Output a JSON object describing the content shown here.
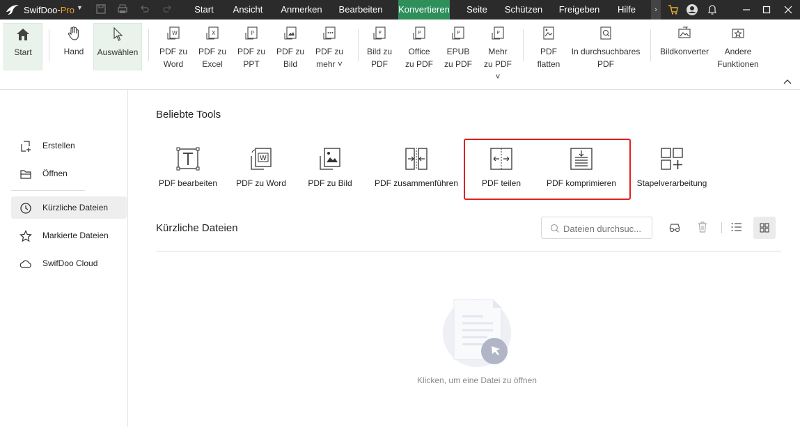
{
  "app": {
    "name": "SwifDoo-",
    "name_suffix": "Pro"
  },
  "menu": [
    "Start",
    "Ansicht",
    "Anmerken",
    "Bearbeiten",
    "Konvertieren",
    "Seite",
    "Schützen",
    "Freigeben",
    "Hilfe"
  ],
  "menu_active": "Konvertieren",
  "ribbon": {
    "start": "Start",
    "hand": "Hand",
    "select": "Auswählen",
    "pdf_word": "PDF zu\nWord",
    "pdf_excel": "PDF zu\nExcel",
    "pdf_ppt": "PDF zu\nPPT",
    "pdf_image": "PDF zu\nBild",
    "pdf_more": "PDF zu\nmehr ˅",
    "image_pdf": "Bild zu\nPDF",
    "office_pdf": "Office\nzu PDF",
    "epub_pdf": "EPUB\nzu PDF",
    "more_pdf": "Mehr\nzu PDF ˅",
    "pdf_flatten": "PDF\nflatten",
    "searchable_pdf": "In durchsuchbares\nPDF",
    "image_converter": "Bildkonverter",
    "other_functions": "Andere\nFunktionen"
  },
  "sidebar": {
    "create": "Erstellen",
    "open": "Öffnen",
    "recent": "Kürzliche Dateien",
    "starred": "Markierte Dateien",
    "cloud": "SwifDoo Cloud"
  },
  "popular": {
    "title": "Beliebte Tools",
    "tools": [
      "PDF bearbeiten",
      "PDF zu Word",
      "PDF zu Bild",
      "PDF zusammenführen",
      "PDF teilen",
      "PDF komprimieren",
      "Stapelverarbeitung"
    ]
  },
  "recent": {
    "title": "Kürzliche Dateien",
    "search_placeholder": "Dateien durchsuc...",
    "empty_text": "Klicken, um eine Datei zu öffnen"
  },
  "colors": {
    "accent": "#2f8f5b",
    "titlebar": "#2b2b2b",
    "highlight": "#e02020"
  }
}
